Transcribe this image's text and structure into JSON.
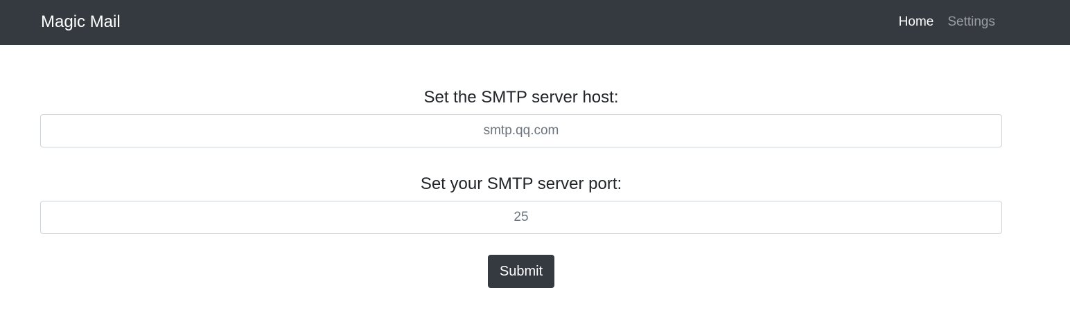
{
  "navbar": {
    "brand": "Magic Mail",
    "links": [
      {
        "label": "Home",
        "active": true
      },
      {
        "label": "Settings",
        "active": false
      }
    ],
    "background": "#343a40"
  },
  "form": {
    "host": {
      "label": "Set the SMTP server host:",
      "placeholder": "smtp.qq.com",
      "value": ""
    },
    "port": {
      "label": "Set your SMTP server port:",
      "placeholder": "25",
      "value": ""
    },
    "submit_label": "Submit"
  }
}
